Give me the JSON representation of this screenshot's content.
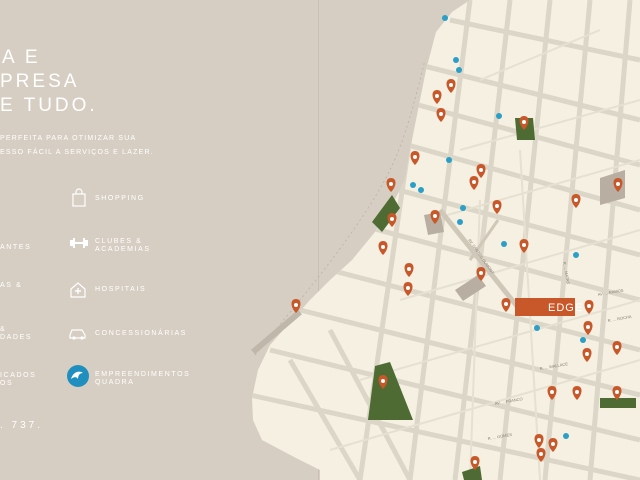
{
  "headline": {
    "line1": "A E",
    "line2": "PRESA",
    "line3": "E TUDO."
  },
  "intro": {
    "line1": "PERFEITA PARA OTIMIZAR SUA",
    "line2": "ESSO FÁCIL A SERVIÇOS E LAZER."
  },
  "legend_left": [
    {
      "label_lines": [
        "ANTES"
      ]
    },
    {
      "label_lines": [
        "AS &"
      ]
    },
    {
      "label_lines": [
        "&",
        "DADES"
      ]
    },
    {
      "label_lines": [
        "ICADOS",
        "OS"
      ]
    }
  ],
  "legend_right": [
    {
      "icon": "shopping-bag-icon",
      "label_lines": [
        "SHOPPING"
      ]
    },
    {
      "icon": "dumbbell-icon",
      "label_lines": [
        "CLUBES &",
        "ACADEMIAS"
      ]
    },
    {
      "icon": "hospital-icon",
      "label_lines": [
        "HOSPITAIS"
      ]
    },
    {
      "icon": "car-icon",
      "label_lines": [
        "CONCESSIONÁRIAS"
      ]
    },
    {
      "icon": "quadra-wave-icon",
      "label_lines": [
        "EMPREENDIMENTOS",
        "QUADRA"
      ]
    }
  ],
  "phone": ". 737.",
  "map": {
    "project_label": "EDGE",
    "street_labels": [
      "AV. SANTOS DUMONT",
      "R. ... MATAS",
      "AV. ... RAMOS",
      "R. ... WALLACE",
      "R. ... ROCHA",
      "AV. ... FRANCO",
      "R. ... GOMES"
    ],
    "colors": {
      "background": "#d6cec2",
      "land": "#f5f0e1",
      "street": "#d8d2c4",
      "park": "#4f6b34",
      "block": "#b8afa2",
      "pin": "#c8582a",
      "quadra": "#2a9fc8",
      "project": "#c8582a"
    }
  }
}
